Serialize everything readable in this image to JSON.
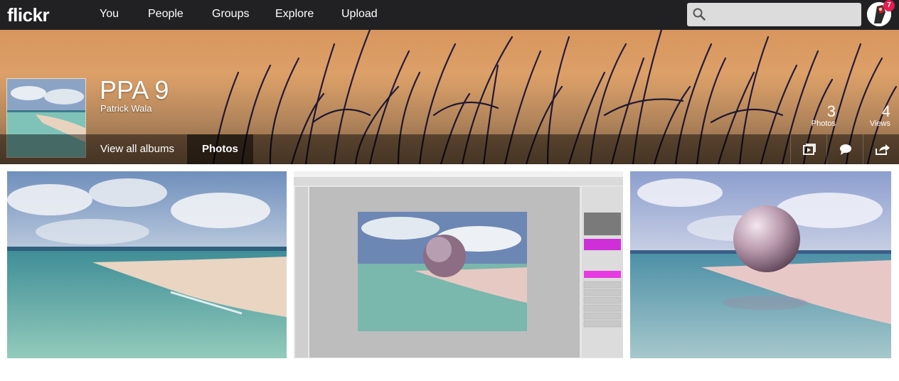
{
  "nav": {
    "logo": "flickr",
    "items": [
      "You",
      "People",
      "Groups",
      "Explore",
      "Upload"
    ],
    "search_placeholder": "",
    "notification_count": "7"
  },
  "album": {
    "title": "PPA 9",
    "owner": "Patrick Wala",
    "stats": {
      "photos_count": "3",
      "photos_label": "Photos",
      "views_count": "4",
      "views_label": "Views"
    },
    "subnav": {
      "view_all": "View all albums",
      "photos": "Photos"
    }
  },
  "colors": {
    "topbar": "#212124",
    "accent_badge": "#e61b4e",
    "cover_sky": "#d9a26f"
  },
  "icons": [
    "search-icon",
    "slideshow-icon",
    "comment-icon",
    "share-icon"
  ]
}
